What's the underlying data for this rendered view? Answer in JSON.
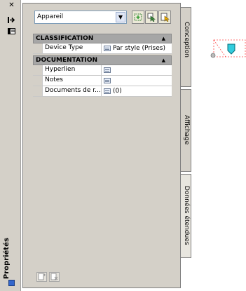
{
  "panel": {
    "title": "Propriétés",
    "combo_value": "Appareil",
    "tabs": [
      "Conception",
      "Affichage",
      "Données étendues"
    ]
  },
  "categories": [
    {
      "label": "CLASSIFICATION",
      "rows": [
        {
          "name": "Device Type",
          "value": "Par style (Prises)"
        }
      ]
    },
    {
      "label": "DOCUMENTATION",
      "rows": [
        {
          "name": "Hyperlien",
          "value": ""
        },
        {
          "name": "Notes",
          "value": ""
        },
        {
          "name": "Documents de r...",
          "value": "(0)"
        }
      ]
    }
  ],
  "icons": {
    "close": "close-icon",
    "autohide": "autohide-icon",
    "menu": "palette-menu-icon",
    "select_similar": "select-similar-icon",
    "quick_select": "quick-select-icon",
    "toggle_pickadd": "toggle-pickadd-icon"
  },
  "colors": {
    "panel_bg": "#d4d0c8",
    "category_bg": "#a6a6a6",
    "device_cyan": "#33ccdd",
    "selection_red": "#ff4444"
  }
}
